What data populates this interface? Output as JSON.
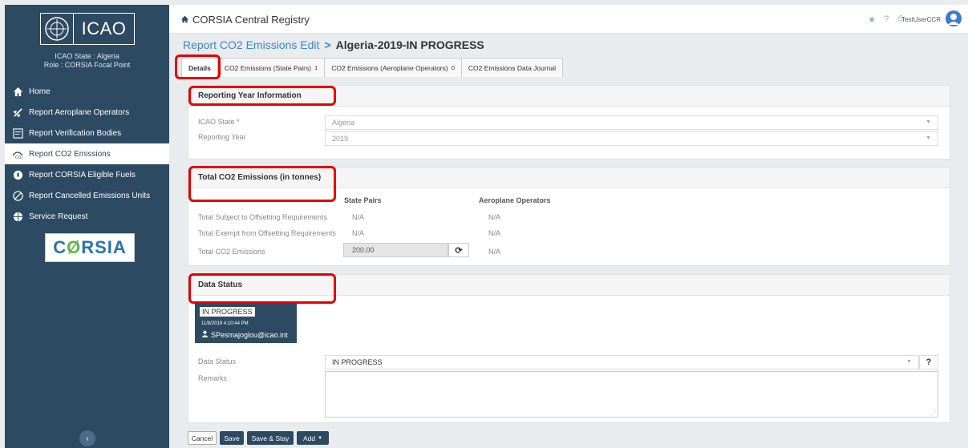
{
  "sidebar": {
    "logo_text": "ICAO",
    "state_line": "ICAO State : Algeria",
    "role_line": "Role : CORSIA Focal Point",
    "items": [
      {
        "label": "Home",
        "icon": "home-icon"
      },
      {
        "label": "Report Aeroplane Operators",
        "icon": "airplane-icon"
      },
      {
        "label": "Report Verification Bodies",
        "icon": "report-icon"
      },
      {
        "label": "Report CO2 Emissions",
        "icon": "emissions-icon"
      },
      {
        "label": "Report CORSIA Eligible Fuels",
        "icon": "fuel-drop-icon"
      },
      {
        "label": "Report Cancelled Emissions Units",
        "icon": "cancel-icon"
      },
      {
        "label": "Service Request",
        "icon": "globe-icon"
      }
    ],
    "active_index": 3,
    "corsia_logo_before": "C",
    "corsia_logo_o": "Ø",
    "corsia_logo_after": "RSIA"
  },
  "topbar": {
    "title": "CORSIA Central Registry",
    "user": "TestUserCCR",
    "icons": [
      "star-icon",
      "help-icon",
      "print-icon"
    ]
  },
  "breadcrumb": {
    "link": "Report CO2 Emissions Edit",
    "separator": ">",
    "current": "Algeria-2019-IN PROGRESS"
  },
  "tabs": [
    {
      "label": "Details",
      "count": ""
    },
    {
      "label": "CO2 Emissions (State Pairs)",
      "count": "1"
    },
    {
      "label": "CO2 Emissions (Aeroplane Operators)",
      "count": "0"
    },
    {
      "label": "CO2 Emissions Data Journal",
      "count": ""
    }
  ],
  "reporting_year": {
    "heading": "Reporting Year Information",
    "state_label": "ICAO State *",
    "state_value": "Algeria",
    "year_label": "Reporting Year",
    "year_value": "2019"
  },
  "totals": {
    "heading": "Total CO2 Emissions (in tonnes)",
    "col_state_pairs": "State Pairs",
    "col_operators": "Aeroplane Operators",
    "rows": [
      {
        "label": "Total Subject to Offsetting Requirements",
        "state_pairs": "N/A",
        "operators": "N/A"
      },
      {
        "label": "Total Exempt from Offsetting Requirements",
        "state_pairs": "N/A",
        "operators": "N/A"
      },
      {
        "label": "Total CO2 Emissions",
        "state_pairs": "200.00",
        "operators": "N/A"
      }
    ]
  },
  "data_status": {
    "heading": "Data Status",
    "badge": "IN PROGRESS",
    "timestamp": "11/8/2019 4:10:44 PM",
    "user": "SPesmajoglou@icao.int",
    "status_label": "Data Status",
    "status_value": "IN PROGRESS",
    "remarks_label": "Remarks",
    "help_label": "?"
  },
  "buttons": {
    "cancel": "Cancel",
    "save": "Save",
    "save_stay": "Save & Stay",
    "add": "Add"
  },
  "colors": {
    "sidebar": "#2d4a63",
    "link": "#3a86c8",
    "highlight": "#e40000"
  }
}
